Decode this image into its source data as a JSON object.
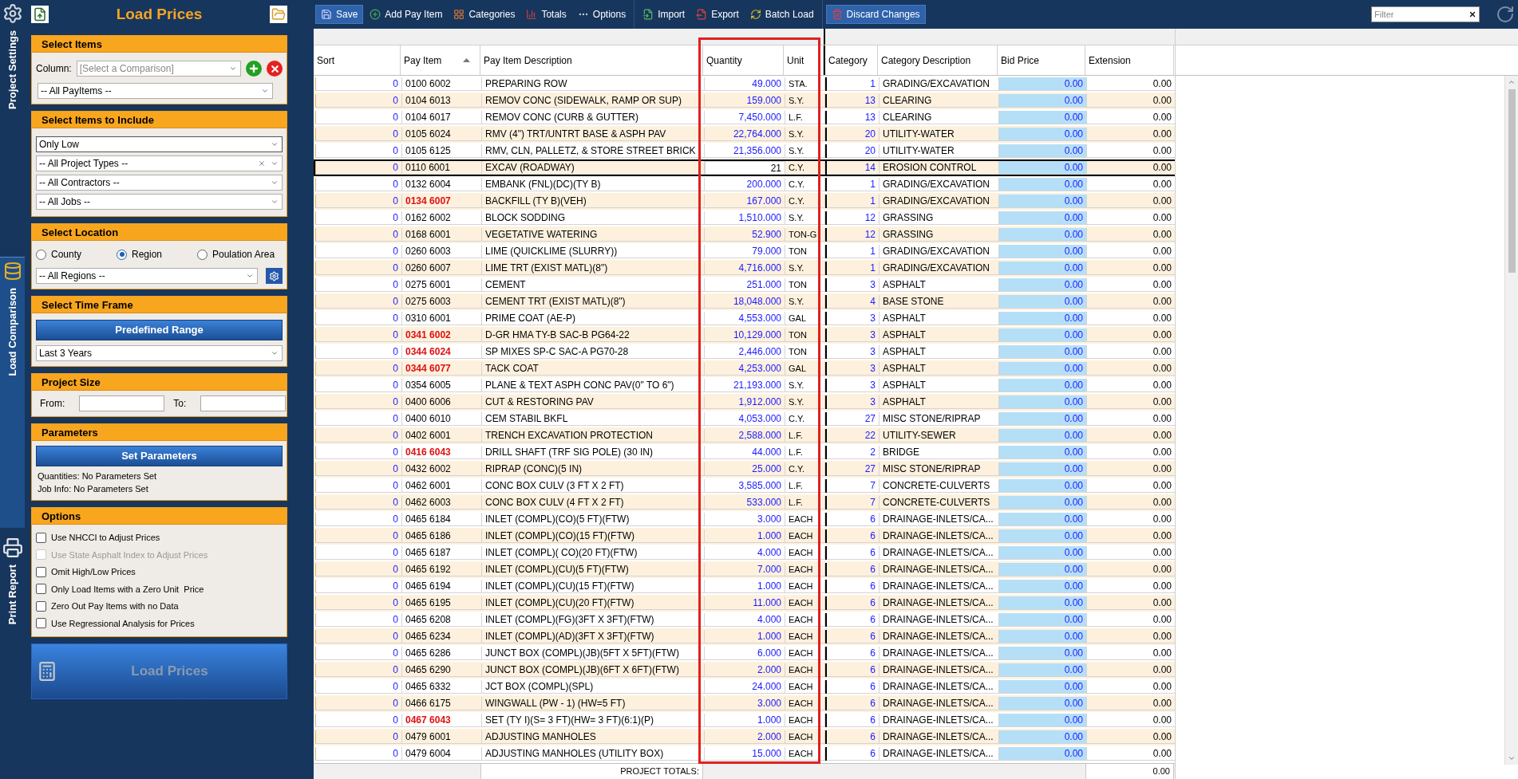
{
  "side_tabs": [
    {
      "label": "Project Settings",
      "selected": false
    },
    {
      "label": "Load Comparison",
      "selected": true
    },
    {
      "label": "Print Report",
      "selected": false
    }
  ],
  "panel_title": "Load Prices",
  "select_items": {
    "title": "Select Items",
    "column_label": "Column:",
    "column_placeholder": "[Select a Comparison]",
    "payitems": "-- All PayItems --"
  },
  "include": {
    "title": "Select Items to Include",
    "dropdowns": [
      {
        "value": "Only Low",
        "clearable": false
      },
      {
        "value": "-- All Project Types --",
        "clearable": true
      },
      {
        "value": "-- All Contractors --",
        "clearable": false
      },
      {
        "value": "-- All Jobs --",
        "clearable": false
      }
    ]
  },
  "location": {
    "title": "Select Location",
    "options": [
      {
        "label": "County",
        "selected": false
      },
      {
        "label": "Region",
        "selected": true
      },
      {
        "label": "Poulation Area",
        "selected": false
      }
    ],
    "region": "-- All Regions --"
  },
  "time_frame": {
    "title": "Select Time Frame",
    "button": "Predefined Range",
    "range": "Last 3 Years"
  },
  "project_size": {
    "title": "Project Size",
    "from_label": "From:",
    "to_label": "To:"
  },
  "parameters": {
    "title": "Parameters",
    "button": "Set Parameters",
    "lines": [
      "Quantities: No Parameters Set",
      "Job Info: No Parameters Set"
    ]
  },
  "options": {
    "title": "Options",
    "items": [
      {
        "label": "Use NHCCI to Adjust Prices",
        "checked": false,
        "disabled": false
      },
      {
        "label": "Use State Asphalt Index to Adjust Prices",
        "checked": false,
        "disabled": true
      },
      {
        "label": "Omit High/Low Prices",
        "checked": false,
        "disabled": false
      },
      {
        "label": "Only Load Items with a Zero Unit  Price",
        "checked": false,
        "disabled": false
      },
      {
        "label": "Zero Out Pay Items with no Data",
        "checked": false,
        "disabled": false
      },
      {
        "label": "Use Regressional Analysis for Prices",
        "checked": false,
        "disabled": false
      }
    ]
  },
  "load_button": {
    "label": "Load Prices",
    "disabled": true
  },
  "toolbar": [
    [
      {
        "label": "Save",
        "highlighted": true
      },
      {
        "label": "Add Pay Item",
        "highlighted": false
      },
      {
        "label": "Categories",
        "highlighted": false
      },
      {
        "label": "Totals",
        "highlighted": false
      },
      {
        "label": "Options",
        "highlighted": false
      }
    ],
    [
      {
        "label": "Import",
        "highlighted": false
      },
      {
        "label": "Export",
        "highlighted": false
      },
      {
        "label": "Batch Load",
        "highlighted": false
      }
    ],
    [
      {
        "label": "Discard Changes",
        "highlighted": true
      }
    ]
  ],
  "filter": {
    "placeholder": "Filter"
  },
  "table": {
    "columns": [
      {
        "label": "Sort",
        "sorted": false
      },
      {
        "label": "Pay Item",
        "sorted": true
      },
      {
        "label": "Pay Item Description",
        "sorted": false
      },
      {
        "label": "Quantity",
        "sorted": false
      },
      {
        "label": "Unit",
        "sorted": false
      },
      {
        "label": "Category",
        "sorted": false
      },
      {
        "label": "Category Description",
        "sorted": false
      },
      {
        "label": "Bid Price",
        "sorted": false
      },
      {
        "label": "Extension",
        "sorted": false
      }
    ],
    "rows": [
      {
        "sort": "0",
        "pay_item": "0100 6002",
        "flagged": false,
        "description": "PREPARING ROW",
        "quantity": "49.000",
        "unit": "STA.",
        "category": "1",
        "category_description": "GRADING/EXCAVATION",
        "bid_price": "0.00",
        "extension": "0.00",
        "selected": false
      },
      {
        "sort": "0",
        "pay_item": "0104 6013",
        "flagged": false,
        "description": "REMOV CONC (SIDEWALK, RAMP OR SUP)",
        "quantity": "159.000",
        "unit": "S.Y.",
        "category": "13",
        "category_description": "CLEARING",
        "bid_price": "0.00",
        "extension": "0.00",
        "selected": false
      },
      {
        "sort": "0",
        "pay_item": "0104 6017",
        "flagged": false,
        "description": "REMOV CONC (CURB & GUTTER)",
        "quantity": "7,450.000",
        "unit": "L.F.",
        "category": "13",
        "category_description": "CLEARING",
        "bid_price": "0.00",
        "extension": "0.00",
        "selected": false
      },
      {
        "sort": "0",
        "pay_item": "0105 6024",
        "flagged": false,
        "description": "RMV (4\") TRT/UNTRT BASE & ASPH PAV",
        "quantity": "22,764.000",
        "unit": "S.Y.",
        "category": "20",
        "category_description": "UTILITY-WATER",
        "bid_price": "0.00",
        "extension": "0.00",
        "selected": false
      },
      {
        "sort": "0",
        "pay_item": "0105 6125",
        "flagged": false,
        "description": "RMV, CLN, PALLETZ, & STORE STREET BRICK",
        "quantity": "21,356.000",
        "unit": "S.Y.",
        "category": "20",
        "category_description": "UTILITY-WATER",
        "bid_price": "0.00",
        "extension": "0.00",
        "selected": false
      },
      {
        "sort": "0",
        "pay_item": "0110 6001",
        "flagged": false,
        "description": "EXCAV (ROADWAY)",
        "quantity": "21",
        "unit": "C.Y.",
        "category": "14",
        "category_description": "EROSION CONTROL",
        "bid_price": "0.00",
        "extension": "0.00",
        "selected": true
      },
      {
        "sort": "0",
        "pay_item": "0132 6004",
        "flagged": false,
        "description": "EMBANK (FNL)(DC)(TY B)",
        "quantity": "200.000",
        "unit": "C.Y.",
        "category": "1",
        "category_description": "GRADING/EXCAVATION",
        "bid_price": "0.00",
        "extension": "0.00",
        "selected": false
      },
      {
        "sort": "0",
        "pay_item": "0134 6007",
        "flagged": true,
        "description": "BACKFILL (TY B)(VEH)",
        "quantity": "167.000",
        "unit": "C.Y.",
        "category": "1",
        "category_description": "GRADING/EXCAVATION",
        "bid_price": "0.00",
        "extension": "0.00",
        "selected": false
      },
      {
        "sort": "0",
        "pay_item": "0162 6002",
        "flagged": false,
        "description": "BLOCK SODDING",
        "quantity": "1,510.000",
        "unit": "S.Y.",
        "category": "12",
        "category_description": "GRASSING",
        "bid_price": "0.00",
        "extension": "0.00",
        "selected": false
      },
      {
        "sort": "0",
        "pay_item": "0168 6001",
        "flagged": false,
        "description": "VEGETATIVE WATERING",
        "quantity": "52.900",
        "unit": "TON-G",
        "category": "12",
        "category_description": "GRASSING",
        "bid_price": "0.00",
        "extension": "0.00",
        "selected": false
      },
      {
        "sort": "0",
        "pay_item": "0260 6003",
        "flagged": false,
        "description": "LIME (QUICKLIME (SLURRY))",
        "quantity": "79.000",
        "unit": "TON",
        "category": "1",
        "category_description": "GRADING/EXCAVATION",
        "bid_price": "0.00",
        "extension": "0.00",
        "selected": false
      },
      {
        "sort": "0",
        "pay_item": "0260 6007",
        "flagged": false,
        "description": "LIME TRT (EXIST MATL)(8\")",
        "quantity": "4,716.000",
        "unit": "S.Y.",
        "category": "1",
        "category_description": "GRADING/EXCAVATION",
        "bid_price": "0.00",
        "extension": "0.00",
        "selected": false
      },
      {
        "sort": "0",
        "pay_item": "0275 6001",
        "flagged": false,
        "description": "CEMENT",
        "quantity": "251.000",
        "unit": "TON",
        "category": "3",
        "category_description": "ASPHALT",
        "bid_price": "0.00",
        "extension": "0.00",
        "selected": false
      },
      {
        "sort": "0",
        "pay_item": "0275 6003",
        "flagged": false,
        "description": "CEMENT TRT (EXIST MATL)(8\")",
        "quantity": "18,048.000",
        "unit": "S.Y.",
        "category": "4",
        "category_description": "BASE STONE",
        "bid_price": "0.00",
        "extension": "0.00",
        "selected": false
      },
      {
        "sort": "0",
        "pay_item": "0310 6001",
        "flagged": false,
        "description": "PRIME COAT (AE-P)",
        "quantity": "4,553.000",
        "unit": "GAL",
        "category": "3",
        "category_description": "ASPHALT",
        "bid_price": "0.00",
        "extension": "0.00",
        "selected": false
      },
      {
        "sort": "0",
        "pay_item": "0341 6002",
        "flagged": true,
        "description": "D-GR HMA TY-B SAC-B PG64-22",
        "quantity": "10,129.000",
        "unit": "TON",
        "category": "3",
        "category_description": "ASPHALT",
        "bid_price": "0.00",
        "extension": "0.00",
        "selected": false
      },
      {
        "sort": "0",
        "pay_item": "0344 6024",
        "flagged": true,
        "description": "SP MIXES SP-C SAC-A PG70-28",
        "quantity": "2,446.000",
        "unit": "TON",
        "category": "3",
        "category_description": "ASPHALT",
        "bid_price": "0.00",
        "extension": "0.00",
        "selected": false
      },
      {
        "sort": "0",
        "pay_item": "0344 6077",
        "flagged": true,
        "description": "TACK COAT",
        "quantity": "4,253.000",
        "unit": "GAL",
        "category": "3",
        "category_description": "ASPHALT",
        "bid_price": "0.00",
        "extension": "0.00",
        "selected": false
      },
      {
        "sort": "0",
        "pay_item": "0354 6005",
        "flagged": false,
        "description": "PLANE & TEXT ASPH CONC PAV(0\" TO 6\")",
        "quantity": "21,193.000",
        "unit": "S.Y.",
        "category": "3",
        "category_description": "ASPHALT",
        "bid_price": "0.00",
        "extension": "0.00",
        "selected": false
      },
      {
        "sort": "0",
        "pay_item": "0400 6006",
        "flagged": false,
        "description": "CUT & RESTORING PAV",
        "quantity": "1,912.000",
        "unit": "S.Y.",
        "category": "3",
        "category_description": "ASPHALT",
        "bid_price": "0.00",
        "extension": "0.00",
        "selected": false
      },
      {
        "sort": "0",
        "pay_item": "0400 6010",
        "flagged": false,
        "description": "CEM STABIL BKFL",
        "quantity": "4,053.000",
        "unit": "C.Y.",
        "category": "27",
        "category_description": "MISC STONE/RIPRAP",
        "bid_price": "0.00",
        "extension": "0.00",
        "selected": false
      },
      {
        "sort": "0",
        "pay_item": "0402 6001",
        "flagged": false,
        "description": "TRENCH EXCAVATION PROTECTION",
        "quantity": "2,588.000",
        "unit": "L.F.",
        "category": "22",
        "category_description": "UTILITY-SEWER",
        "bid_price": "0.00",
        "extension": "0.00",
        "selected": false
      },
      {
        "sort": "0",
        "pay_item": "0416 6043",
        "flagged": true,
        "description": "DRILL SHAFT (TRF SIG POLE) (30 IN)",
        "quantity": "44.000",
        "unit": "L.F.",
        "category": "2",
        "category_description": "BRIDGE",
        "bid_price": "0.00",
        "extension": "0.00",
        "selected": false
      },
      {
        "sort": "0",
        "pay_item": "0432 6002",
        "flagged": false,
        "description": "RIPRAP (CONC)(5 IN)",
        "quantity": "25.000",
        "unit": "C.Y.",
        "category": "27",
        "category_description": "MISC STONE/RIPRAP",
        "bid_price": "0.00",
        "extension": "0.00",
        "selected": false
      },
      {
        "sort": "0",
        "pay_item": "0462 6001",
        "flagged": false,
        "description": "CONC BOX CULV (3 FT X 2 FT)",
        "quantity": "3,585.000",
        "unit": "L.F.",
        "category": "7",
        "category_description": "CONCRETE-CULVERTS",
        "bid_price": "0.00",
        "extension": "0.00",
        "selected": false
      },
      {
        "sort": "0",
        "pay_item": "0462 6003",
        "flagged": false,
        "description": "CONC BOX CULV (4 FT X 2 FT)",
        "quantity": "533.000",
        "unit": "L.F.",
        "category": "7",
        "category_description": "CONCRETE-CULVERTS",
        "bid_price": "0.00",
        "extension": "0.00",
        "selected": false
      },
      {
        "sort": "0",
        "pay_item": "0465 6184",
        "flagged": false,
        "description": "INLET (COMPL)(CO)(5 FT)(FTW)",
        "quantity": "3.000",
        "unit": "EACH",
        "category": "6",
        "category_description": "DRAINAGE-INLETS/CA...",
        "bid_price": "0.00",
        "extension": "0.00",
        "selected": false
      },
      {
        "sort": "0",
        "pay_item": "0465 6186",
        "flagged": false,
        "description": "INLET (COMPL)(CO)(15 FT)(FTW)",
        "quantity": "1.000",
        "unit": "EACH",
        "category": "6",
        "category_description": "DRAINAGE-INLETS/CA...",
        "bid_price": "0.00",
        "extension": "0.00",
        "selected": false
      },
      {
        "sort": "0",
        "pay_item": "0465 6187",
        "flagged": false,
        "description": "INLET (COMPL)( CO)(20 FT)(FTW)",
        "quantity": "4.000",
        "unit": "EACH",
        "category": "6",
        "category_description": "DRAINAGE-INLETS/CA...",
        "bid_price": "0.00",
        "extension": "0.00",
        "selected": false
      },
      {
        "sort": "0",
        "pay_item": "0465 6192",
        "flagged": false,
        "description": "INLET (COMPL)(CU)(5 FT)(FTW)",
        "quantity": "7.000",
        "unit": "EACH",
        "category": "6",
        "category_description": "DRAINAGE-INLETS/CA...",
        "bid_price": "0.00",
        "extension": "0.00",
        "selected": false
      },
      {
        "sort": "0",
        "pay_item": "0465 6194",
        "flagged": false,
        "description": "INLET (COMPL)(CU)(15 FT)(FTW)",
        "quantity": "1.000",
        "unit": "EACH",
        "category": "6",
        "category_description": "DRAINAGE-INLETS/CA...",
        "bid_price": "0.00",
        "extension": "0.00",
        "selected": false
      },
      {
        "sort": "0",
        "pay_item": "0465 6195",
        "flagged": false,
        "description": "INLET (COMPL)(CU)(20 FT)(FTW)",
        "quantity": "11.000",
        "unit": "EACH",
        "category": "6",
        "category_description": "DRAINAGE-INLETS/CA...",
        "bid_price": "0.00",
        "extension": "0.00",
        "selected": false
      },
      {
        "sort": "0",
        "pay_item": "0465 6208",
        "flagged": false,
        "description": "INLET (COMPL)(FG)(3FT X 3FT)(FTW)",
        "quantity": "4.000",
        "unit": "EACH",
        "category": "6",
        "category_description": "DRAINAGE-INLETS/CA...",
        "bid_price": "0.00",
        "extension": "0.00",
        "selected": false
      },
      {
        "sort": "0",
        "pay_item": "0465 6234",
        "flagged": false,
        "description": "INLET (COMPL)(AD)(3FT X 3FT)(FTW)",
        "quantity": "1.000",
        "unit": "EACH",
        "category": "6",
        "category_description": "DRAINAGE-INLETS/CA...",
        "bid_price": "0.00",
        "extension": "0.00",
        "selected": false
      },
      {
        "sort": "0",
        "pay_item": "0465 6286",
        "flagged": false,
        "description": "JUNCT BOX (COMPL)(JB)(5FT X 5FT)(FTW)",
        "quantity": "6.000",
        "unit": "EACH",
        "category": "6",
        "category_description": "DRAINAGE-INLETS/CA...",
        "bid_price": "0.00",
        "extension": "0.00",
        "selected": false
      },
      {
        "sort": "0",
        "pay_item": "0465 6290",
        "flagged": false,
        "description": "JUNCT BOX (COMPL)(JB)(6FT X 6FT)(FTW)",
        "quantity": "2.000",
        "unit": "EACH",
        "category": "6",
        "category_description": "DRAINAGE-INLETS/CA...",
        "bid_price": "0.00",
        "extension": "0.00",
        "selected": false
      },
      {
        "sort": "0",
        "pay_item": "0465 6332",
        "flagged": false,
        "description": "JCT BOX (COMPL)(SPL)",
        "quantity": "24.000",
        "unit": "EACH",
        "category": "6",
        "category_description": "DRAINAGE-INLETS/CA...",
        "bid_price": "0.00",
        "extension": "0.00",
        "selected": false
      },
      {
        "sort": "0",
        "pay_item": "0466 6175",
        "flagged": false,
        "description": "WINGWALL (PW - 1) (HW=5 FT)",
        "quantity": "3.000",
        "unit": "EACH",
        "category": "6",
        "category_description": "DRAINAGE-INLETS/CA...",
        "bid_price": "0.00",
        "extension": "0.00",
        "selected": false
      },
      {
        "sort": "0",
        "pay_item": "0467 6043",
        "flagged": true,
        "description": "SET (TY I)(S= 3 FT)(HW= 3 FT)(6:1)(P)",
        "quantity": "1.000",
        "unit": "EACH",
        "category": "6",
        "category_description": "DRAINAGE-INLETS/CA...",
        "bid_price": "0.00",
        "extension": "0.00",
        "selected": false
      },
      {
        "sort": "0",
        "pay_item": "0479 6001",
        "flagged": false,
        "description": "ADJUSTING MANHOLES",
        "quantity": "2.000",
        "unit": "EACH",
        "category": "6",
        "category_description": "DRAINAGE-INLETS/CA...",
        "bid_price": "0.00",
        "extension": "0.00",
        "selected": false
      },
      {
        "sort": "0",
        "pay_item": "0479 6004",
        "flagged": false,
        "description": "ADJUSTING MANHOLES (UTILITY BOX)",
        "quantity": "15.000",
        "unit": "EACH",
        "category": "6",
        "category_description": "DRAINAGE-INLETS/CA...",
        "bid_price": "0.00",
        "extension": "0.00",
        "selected": false
      }
    ],
    "totals": {
      "label": "PROJECT TOTALS:",
      "value": "0.00"
    }
  }
}
